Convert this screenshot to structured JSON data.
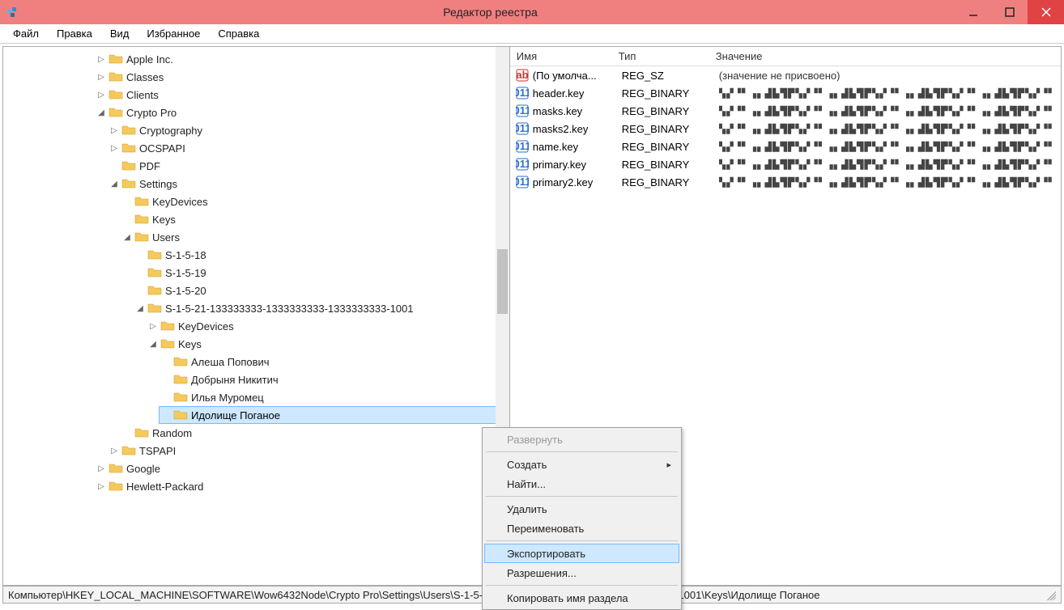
{
  "title": "Редактор реестра",
  "menu": {
    "file": "Файл",
    "edit": "Правка",
    "view": "Вид",
    "fav": "Избранное",
    "help": "Справка"
  },
  "tree": {
    "apple": "Apple Inc.",
    "classes": "Classes",
    "clients": "Clients",
    "cryptopro": "Crypto Pro",
    "cryptography": "Cryptography",
    "ocspapi": "OCSPAPI",
    "pdf": "PDF",
    "settings": "Settings",
    "keydevices": "KeyDevices",
    "keys": "Keys",
    "users": "Users",
    "s18": "S-1-5-18",
    "s19": "S-1-5-19",
    "s20": "S-1-5-20",
    "slong": "S-1-5-21-133333333-1333333333-1333333333-1001",
    "keydevices2": "KeyDevices",
    "keys2": "Keys",
    "k1": "Алеша Попович",
    "k2": "Добрыня Никитич",
    "k3": "Илья Муромец",
    "k4": "Идолище Поганое",
    "random": "Random",
    "tspapi": "TSPAPI",
    "google": "Google",
    "hp": "Hewlett-Packard"
  },
  "list": {
    "cols": {
      "name": "Имя",
      "type": "Тип",
      "value": "Значение"
    },
    "rows": [
      {
        "name": "(По умолча...",
        "type": "REG_SZ",
        "value": "(значение не присвоено)",
        "kind": "sz"
      },
      {
        "name": "header.key",
        "type": "REG_BINARY",
        "value": "",
        "kind": "bin"
      },
      {
        "name": "masks.key",
        "type": "REG_BINARY",
        "value": "",
        "kind": "bin"
      },
      {
        "name": "masks2.key",
        "type": "REG_BINARY",
        "value": "",
        "kind": "bin"
      },
      {
        "name": "name.key",
        "type": "REG_BINARY",
        "value": "",
        "kind": "bin"
      },
      {
        "name": "primary.key",
        "type": "REG_BINARY",
        "value": "",
        "kind": "bin"
      },
      {
        "name": "primary2.key",
        "type": "REG_BINARY",
        "value": "",
        "kind": "bin"
      }
    ]
  },
  "status": "Компьютер\\HKEY_LOCAL_MACHINE\\SOFTWARE\\Wow6432Node\\Crypto Pro\\Settings\\Users\\S-1-5-21-133333333-1333333333-1333333333-1001\\Keys\\Идолище Поганое",
  "ctx": {
    "expand": "Развернуть",
    "new": "Создать",
    "find": "Найти...",
    "delete": "Удалить",
    "rename": "Переименовать",
    "export": "Экспортировать",
    "perms": "Разрешения...",
    "copyname": "Копировать имя раздела"
  }
}
